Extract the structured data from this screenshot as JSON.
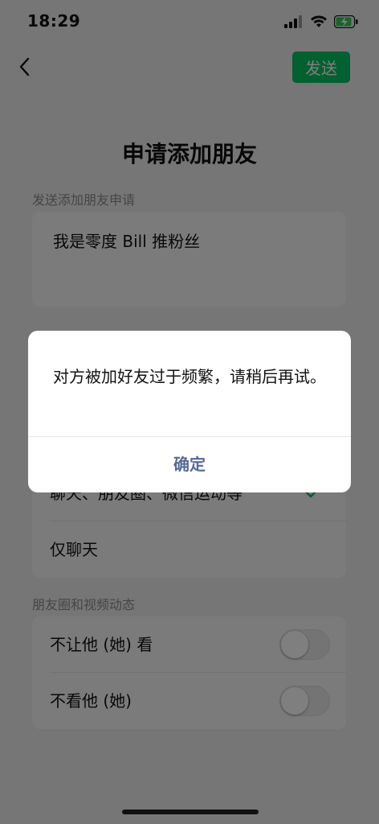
{
  "status": {
    "time": "18:29"
  },
  "header": {
    "send_label": "发送"
  },
  "page": {
    "title": "申请添加朋友"
  },
  "request": {
    "label": "发送添加朋友申请",
    "message": "我是零度 Bill 推粉丝"
  },
  "permissions": {
    "option_all": "聊天、朋友圈、微信运动等",
    "option_chat_only": "仅聊天"
  },
  "moments": {
    "label": "朋友圈和视频动态",
    "hide_mine_label": "不让他 (她) 看",
    "hide_theirs_label": "不看他 (她)",
    "hide_mine_on": false,
    "hide_theirs_on": false
  },
  "dialog": {
    "message": "对方被加好友过于频繁，请稍后再试。",
    "confirm_label": "确定"
  },
  "colors": {
    "accent": "#07c160",
    "link": "#576b95"
  }
}
